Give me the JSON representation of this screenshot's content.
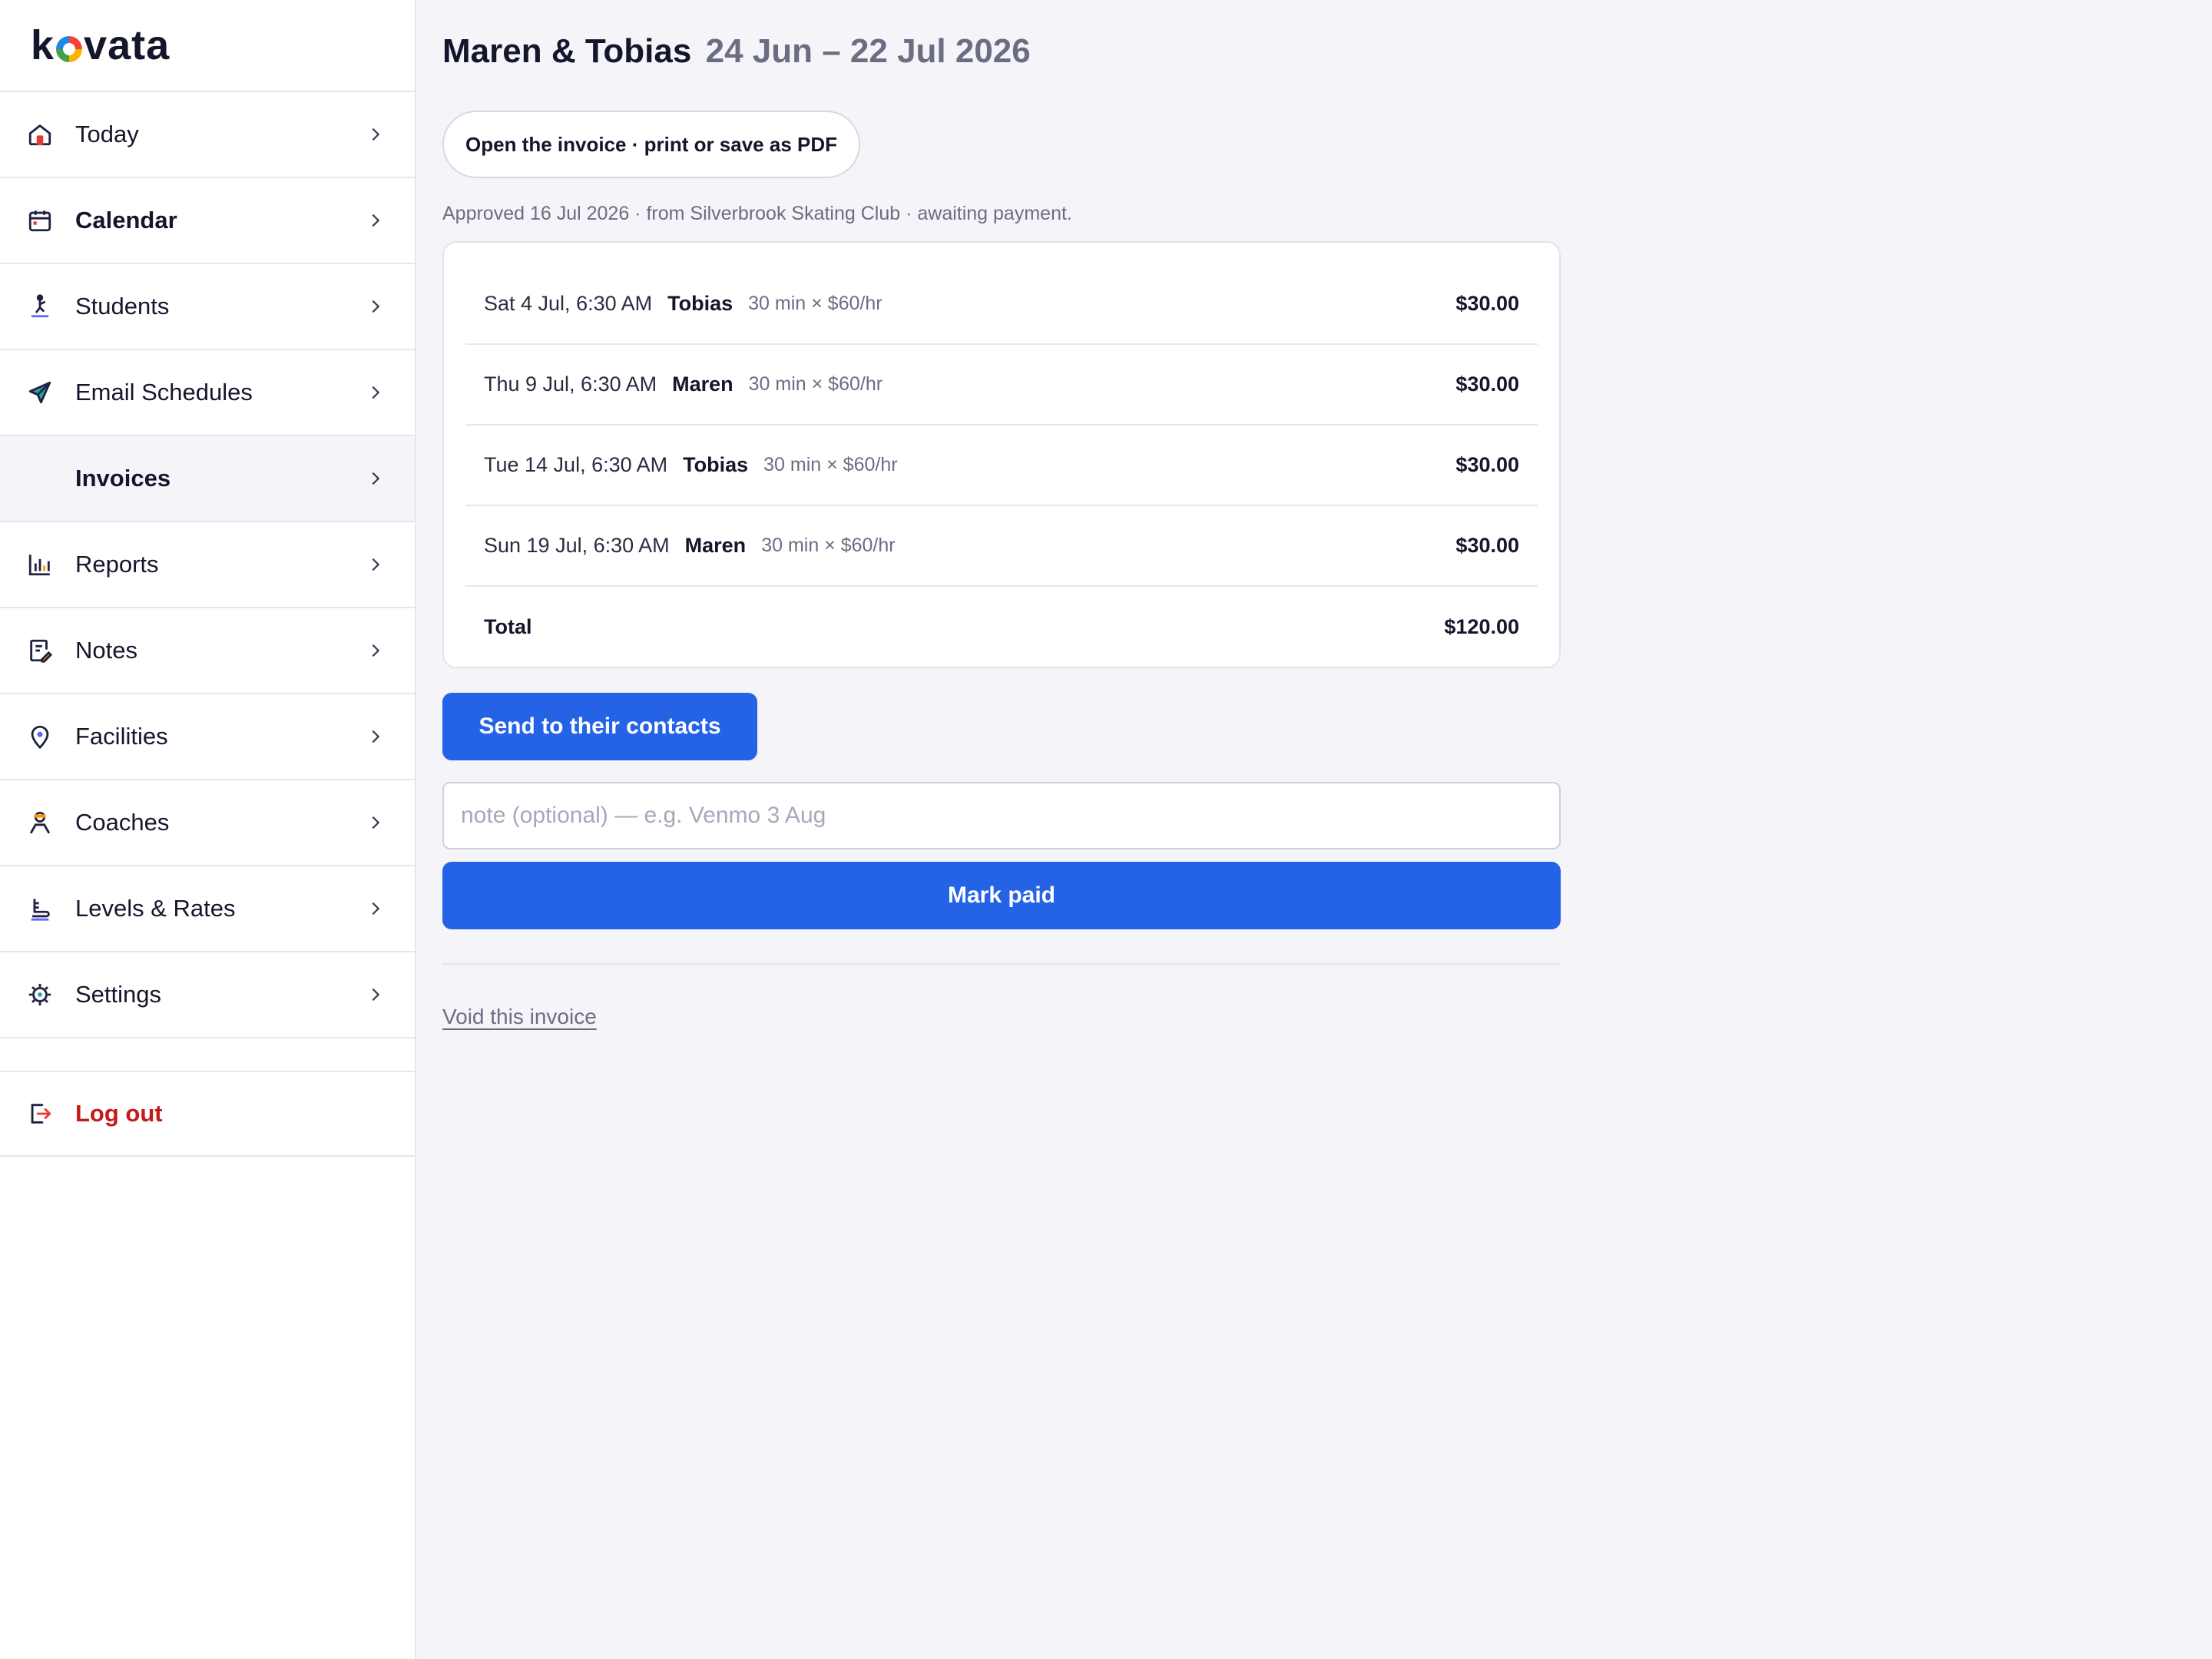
{
  "app": {
    "brand": "kovata"
  },
  "sidebar": {
    "items": [
      {
        "label": "Today"
      },
      {
        "label": "Calendar"
      },
      {
        "label": "Students"
      },
      {
        "label": "Email Schedules"
      },
      {
        "label": "Invoices"
      },
      {
        "label": "Reports"
      },
      {
        "label": "Notes"
      },
      {
        "label": "Facilities"
      },
      {
        "label": "Coaches"
      },
      {
        "label": "Levels & Rates"
      },
      {
        "label": "Settings"
      }
    ],
    "logout": "Log out"
  },
  "invoice": {
    "family": "Maren & Tobias",
    "period": "24 Jun – 22 Jul 2026",
    "pdf_button": "Open the invoice · print or save as PDF",
    "status": "Approved 16 Jul 2026 · from Silverbrook Skating Club · awaiting payment.",
    "lines": [
      {
        "when": "Sat 4 Jul, 6:30 AM",
        "student": "Tobias",
        "calc": "30 min × $60/hr",
        "amount": "$30.00"
      },
      {
        "when": "Thu 9 Jul, 6:30 AM",
        "student": "Maren",
        "calc": "30 min × $60/hr",
        "amount": "$30.00"
      },
      {
        "when": "Tue 14 Jul, 6:30 AM",
        "student": "Tobias",
        "calc": "30 min × $60/hr",
        "amount": "$30.00"
      },
      {
        "when": "Sun 19 Jul, 6:30 AM",
        "student": "Maren",
        "calc": "30 min × $60/hr",
        "amount": "$30.00"
      }
    ],
    "total_label": "Total",
    "total_amount": "$120.00",
    "send_button": "Send to their contacts",
    "note_placeholder": "note (optional) — e.g. Venmo 3 Aug",
    "note_value": "",
    "mark_paid_button": "Mark paid",
    "void_link": "Void this invoice"
  },
  "colors": {
    "accent": "#2563e6",
    "danger": "#c41a1a",
    "background": "#f5f4f9"
  }
}
